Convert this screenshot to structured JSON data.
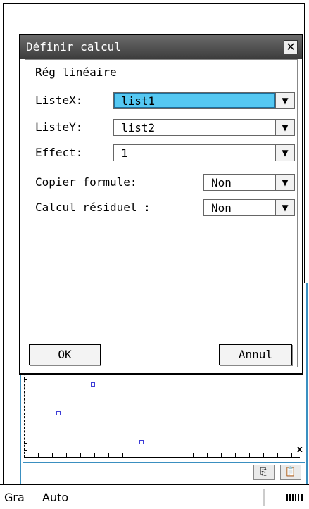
{
  "dialog": {
    "title": "Définir calcul",
    "close_glyph": "✕",
    "calc_type": "Rég linéaire",
    "fields": [
      {
        "label": "ListeX:",
        "value": "list1"
      },
      {
        "label": "ListeY:",
        "value": "list2"
      },
      {
        "label": "Effect:",
        "value": "1"
      },
      {
        "label": "Copier formule:",
        "value": "Non"
      },
      {
        "label": "Calcul résiduel :",
        "value": "Non"
      }
    ],
    "dropdown_glyph": "▼",
    "ok_label": "OK",
    "cancel_label": "Annul"
  },
  "graph": {
    "x_axis_label": "x",
    "copy_icons": [
      "copy-icon",
      "paste-icon"
    ],
    "point_color": "#3d3dd6",
    "frame_color": "#3a8fc0",
    "points": [
      {
        "x": 1.0,
        "y": 1.0
      },
      {
        "x": 0.5,
        "y": 0.6
      },
      {
        "x": 1.7,
        "y": 0.2
      }
    ]
  },
  "status_bar": {
    "mode": "Gra",
    "angle": "Auto",
    "battery_icon": "battery-icon"
  },
  "colors": {
    "focus_fill": "#55c8f2",
    "titlebar": "#4a4a4a"
  }
}
